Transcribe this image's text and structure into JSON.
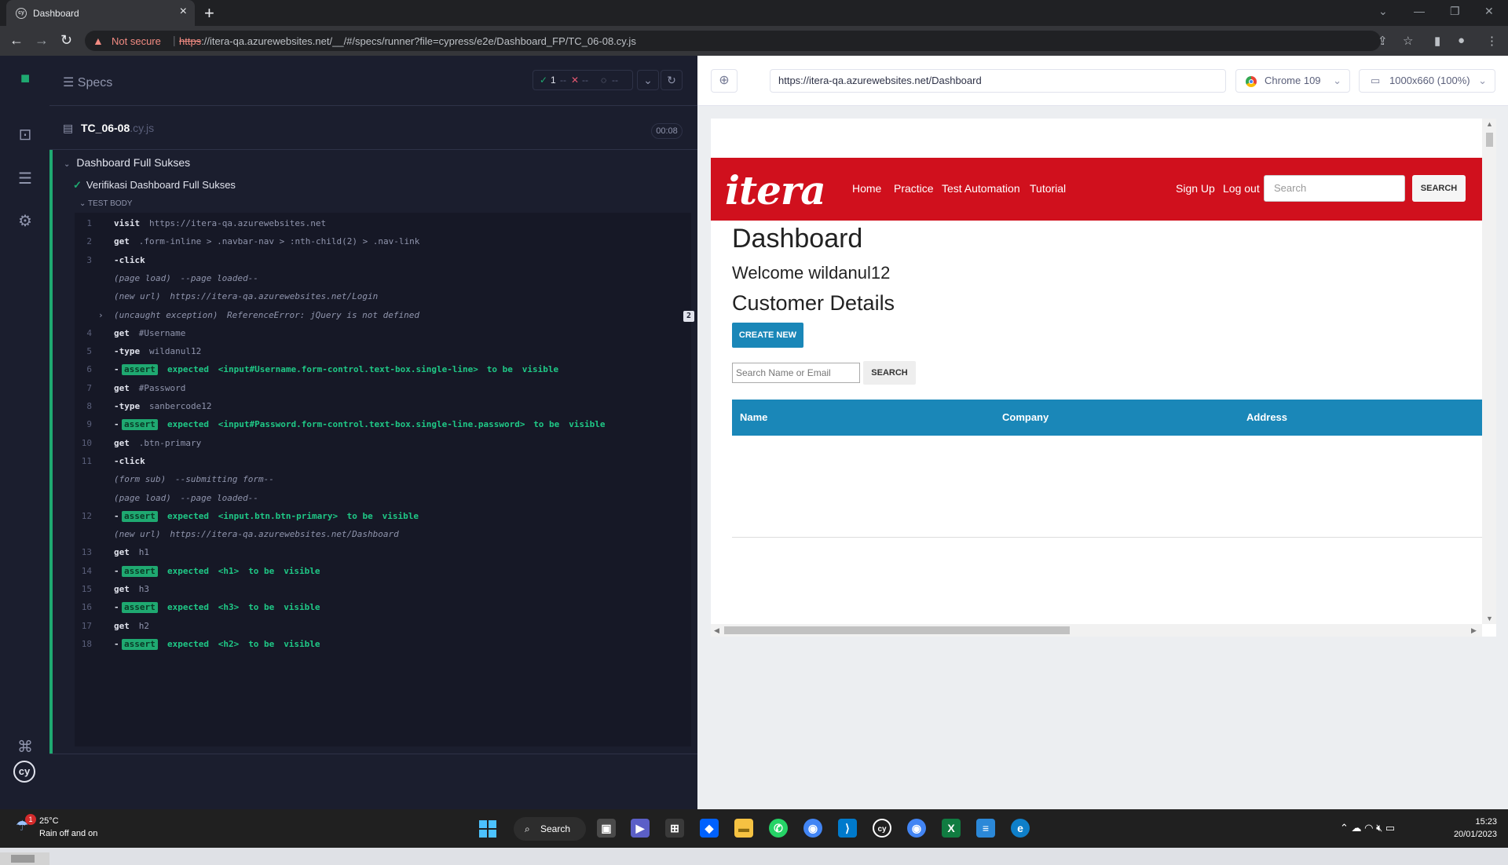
{
  "browser": {
    "tab_title": "Dashboard",
    "new_tab": "+",
    "not_secure": "Not secure",
    "url_scheme": "https",
    "url_rest": "://itera-qa.azurewebsites.net/__/#/specs/runner?file=cypress/e2e/Dashboard_FP/TC_06-08.cy.js",
    "close_tab": "×"
  },
  "cypress": {
    "specs_label": "Specs",
    "passed": "1",
    "failed": "--",
    "pending": "--",
    "spec_file": "TC_06-08",
    "spec_ext": ".cy.js",
    "duration": "00:08",
    "suite": "Dashboard Full Sukses",
    "test": "Verifikasi Dashboard Full Sukses",
    "test_body": "TEST BODY",
    "commands": [
      {
        "n": "1",
        "name": "visit",
        "msg": "https://itera-qa.azurewebsites.net"
      },
      {
        "n": "2",
        "name": "get",
        "msg": ".form-inline > .navbar-nav > :nth-child(2) > .nav-link"
      },
      {
        "n": "3",
        "name": "-click",
        "msg": ""
      },
      {
        "event": "(page load)",
        "msg": "--page loaded--"
      },
      {
        "event": "(new url)",
        "msg": "https://itera-qa.azurewebsites.net/Login"
      },
      {
        "event": "(uncaught exception)",
        "msg": "ReferenceError: jQuery is not defined",
        "count": "2"
      },
      {
        "n": "4",
        "name": "get",
        "msg": "#Username"
      },
      {
        "n": "5",
        "name": "-type",
        "msg": "wildanul12"
      },
      {
        "n": "6",
        "assert": "assert",
        "msg": "expected",
        "target": "<input#Username.form-control.text-box.single-line>",
        "tail": "to be",
        "state": "visible"
      },
      {
        "n": "7",
        "name": "get",
        "msg": "#Password"
      },
      {
        "n": "8",
        "name": "-type",
        "msg": "sanbercode12"
      },
      {
        "n": "9",
        "assert": "assert",
        "msg": "expected",
        "target": "<input#Password.form-control.text-box.single-line.password>",
        "tail": "to be",
        "state": "visible"
      },
      {
        "n": "10",
        "name": "get",
        "msg": ".btn-primary"
      },
      {
        "n": "11",
        "name": "-click",
        "msg": ""
      },
      {
        "event": "(form sub)",
        "msg": "--submitting form--"
      },
      {
        "event": "(page load)",
        "msg": "--page loaded--"
      },
      {
        "n": "12",
        "assert": "assert",
        "msg": "expected",
        "target": "<input.btn.btn-primary>",
        "tail": "to be",
        "state": "visible"
      },
      {
        "event": "(new url)",
        "msg": "https://itera-qa.azurewebsites.net/Dashboard"
      },
      {
        "n": "13",
        "name": "get",
        "msg": "h1"
      },
      {
        "n": "14",
        "assert": "assert",
        "msg": "expected",
        "target": "<h1>",
        "tail": "to be",
        "state": "visible"
      },
      {
        "n": "15",
        "name": "get",
        "msg": "h3"
      },
      {
        "n": "16",
        "assert": "assert",
        "msg": "expected",
        "target": "<h3>",
        "tail": "to be",
        "state": "visible"
      },
      {
        "n": "17",
        "name": "get",
        "msg": "h2"
      },
      {
        "n": "18",
        "assert": "assert",
        "msg": "expected",
        "target": "<h2>",
        "tail": "to be",
        "state": "visible"
      }
    ]
  },
  "aut": {
    "url": "https://itera-qa.azurewebsites.net/Dashboard",
    "browser": "Chrome 109",
    "viewport": "1000x660 (100%)"
  },
  "site": {
    "logo": "itera",
    "nav": [
      "Home",
      "Practice",
      "Test Automation",
      "Tutorial"
    ],
    "nav_right": [
      "Sign Up",
      "Log out"
    ],
    "search_placeholder": "Search",
    "search_button": "SEARCH",
    "h1": "Dashboard",
    "welcome": "Welcome wildanul12",
    "h2": "Customer Details",
    "create_new": "CREATE NEW",
    "search_name_placeholder": "Search Name or Email",
    "search_name_button": "SEARCH",
    "columns": [
      "Name",
      "Company",
      "Address"
    ]
  },
  "taskbar": {
    "temp": "25°C",
    "weather": "Rain off and on",
    "weather_badge": "1",
    "search": "Search",
    "time": "15:23",
    "date": "20/01/2023"
  },
  "colors": {
    "cypress_bg": "#1b1e2e",
    "pass_green": "#1fa971",
    "itera_red": "#d0101d",
    "table_blue": "#1a87b8"
  }
}
